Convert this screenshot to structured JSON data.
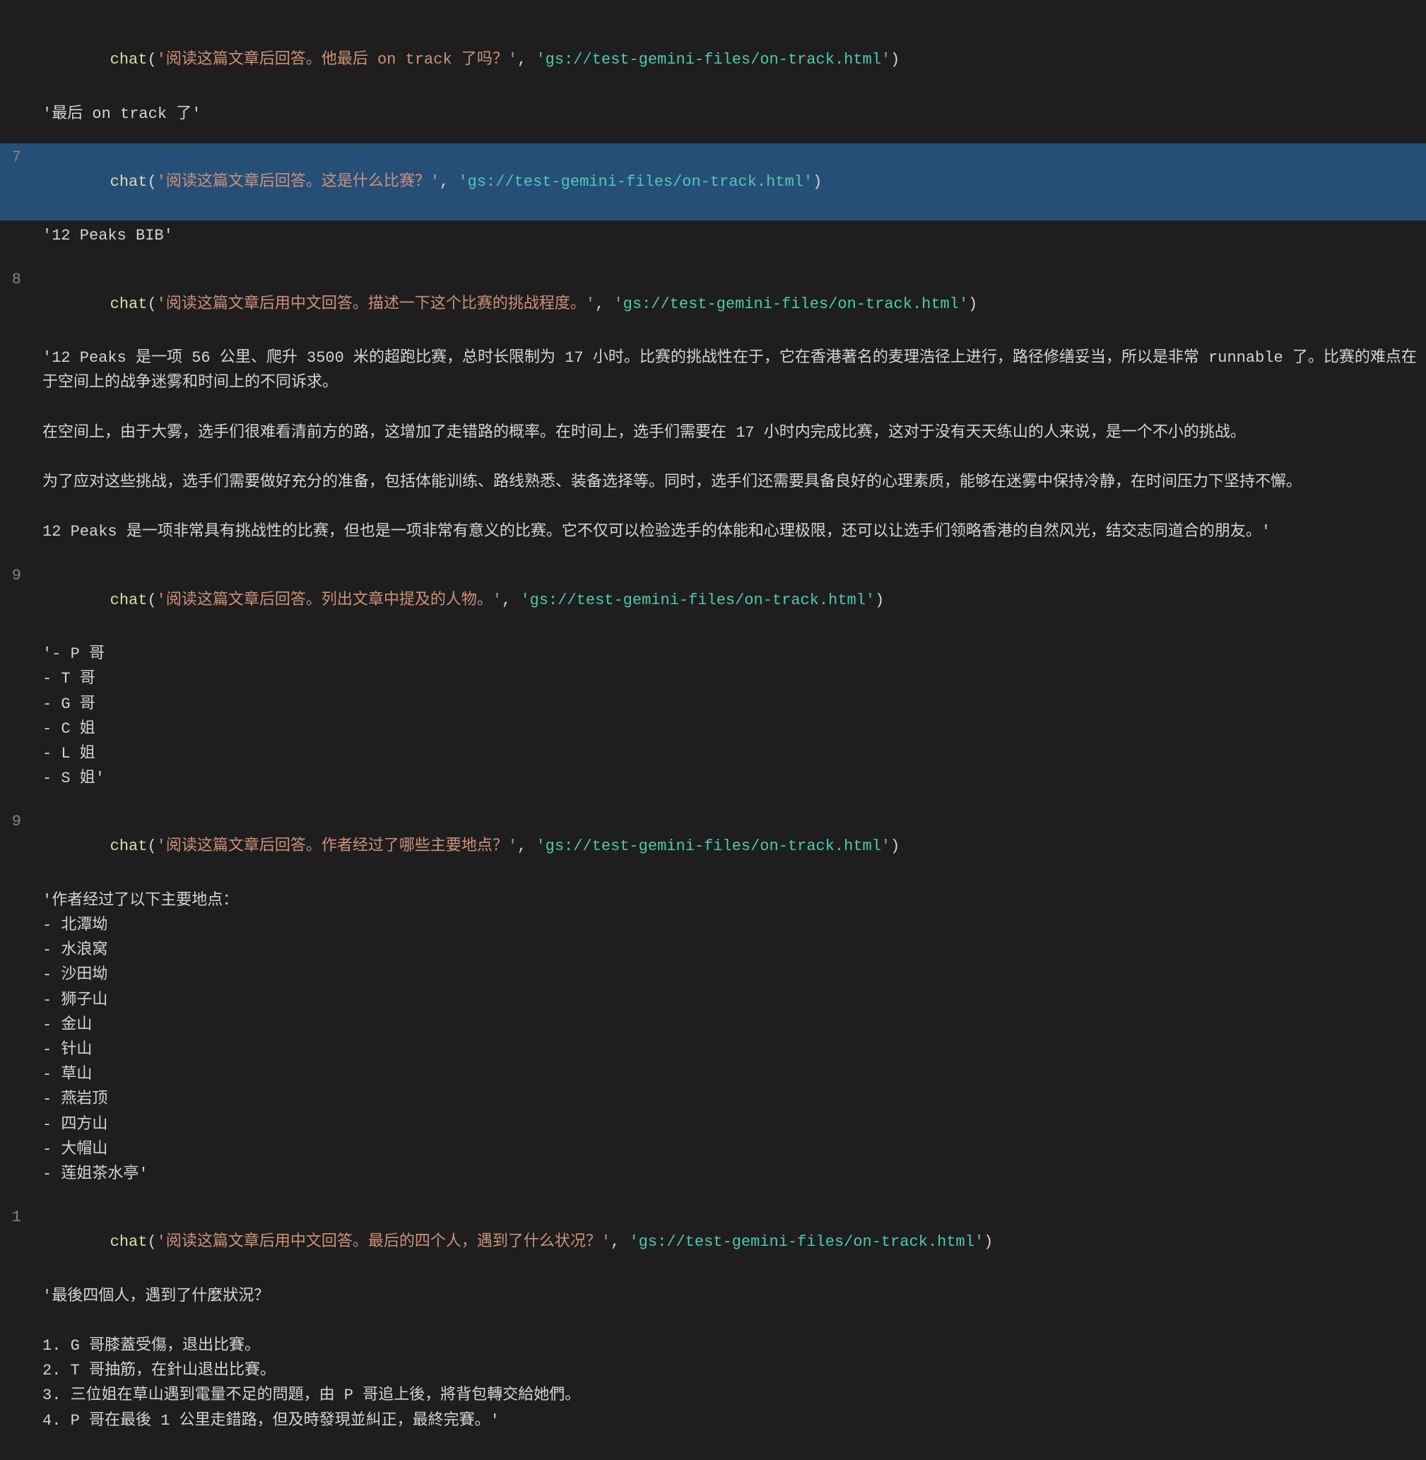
{
  "colors": {
    "background": "#1e1e1e",
    "text": "#d4d4d4",
    "lineNumber": "#858585",
    "keyword": "#dcdcaa",
    "stringRed": "#ce9178",
    "stringTeal": "#4ec9b0",
    "highlight": "#264f78"
  },
  "blocks": [
    {
      "id": "block1",
      "lineNum": "",
      "highlighted": false,
      "callParts": [
        {
          "type": "plain",
          "text": "  "
        },
        {
          "type": "keyword",
          "text": "chat"
        },
        {
          "type": "plain",
          "text": "("
        },
        {
          "type": "string",
          "text": "'阅读这篇文章后回答。他最后 on track 了吗？'"
        },
        {
          "type": "plain",
          "text": ", "
        },
        {
          "type": "string2",
          "text": "'gs://test-gemini-files/on-track.html'"
        },
        {
          "type": "plain",
          "text": ")"
        }
      ],
      "response": "'最后 on track 了'"
    },
    {
      "id": "block2",
      "lineNum": "7",
      "highlighted": true,
      "callParts": [
        {
          "type": "keyword",
          "text": "chat"
        },
        {
          "type": "plain",
          "text": "("
        },
        {
          "type": "string",
          "text": "'阅读这篇文章后回答。这是什么比赛？'"
        },
        {
          "type": "plain",
          "text": ", "
        },
        {
          "type": "string2",
          "text": "'gs://test-gemini-files/on-track.html'"
        },
        {
          "type": "plain",
          "text": ")"
        }
      ],
      "response": "'12 Peaks BIB'"
    },
    {
      "id": "block3",
      "lineNum": "8",
      "highlighted": false,
      "callParts": [
        {
          "type": "keyword",
          "text": "chat"
        },
        {
          "type": "plain",
          "text": "("
        },
        {
          "type": "string",
          "text": "'阅读这篇文章后用中文回答。描述一下这个比赛的挑战程度。'"
        },
        {
          "type": "plain",
          "text": ", "
        },
        {
          "type": "string2",
          "text": "'gs://test-gemini-files/on-track.html'"
        },
        {
          "type": "plain",
          "text": ")"
        }
      ],
      "response": "'12 Peaks 是一项 56 公里、爬升 3500 米的超跑比赛，总时长限制为 17 小时。比赛的挑战性在于，它在香港著名的麦理浩径上进行，路径修缮妥当，所以是非常 runnable 了。比赛的难点在于空间上的战争迷雾和时间上的不同诉求。\\n\\n在空间上，由于大雾，选手们很难看清前方的路，这增加了走错路的概率。在时间上，选手们需要在 17 小时内完成比赛，这对于没有天天练山的人来说，是一个不小的挑战。\\n\\n为了应对这些挑战，选手们需要做好充分的准备，包括体能训练、路线熟悉、装备选择等。同时，选手们还需要具备良好的心理素质，能够在迷雾中保持冷静，在时间压力下坚持不懈。\\n\\n12 Peaks 是一项非常具有挑战性的比赛，但也是一项非常有意义的比赛。它不仅可以检验选手的体能和心理极限，还可以让选手们领略香港的自然风光，结交志同道合的朋友。'"
    },
    {
      "id": "block4",
      "lineNum": "9",
      "highlighted": false,
      "callParts": [
        {
          "type": "keyword",
          "text": "chat"
        },
        {
          "type": "plain",
          "text": "("
        },
        {
          "type": "string",
          "text": "'阅读这篇文章后回答。列出文章中提及的人物。'"
        },
        {
          "type": "plain",
          "text": ", "
        },
        {
          "type": "string2",
          "text": "'gs://test-gemini-files/on-track.html'"
        },
        {
          "type": "plain",
          "text": ")"
        }
      ],
      "response": "'- P 哥\\n- T 哥\\n- G 哥\\n- C 姐\\n- L 姐\\n- S 姐'"
    },
    {
      "id": "block5",
      "lineNum": "9",
      "highlighted": false,
      "callParts": [
        {
          "type": "keyword",
          "text": "chat"
        },
        {
          "type": "plain",
          "text": "("
        },
        {
          "type": "string",
          "text": "'阅读这篇文章后回答。作者经过了哪些主要地点？'"
        },
        {
          "type": "plain",
          "text": ", "
        },
        {
          "type": "string2",
          "text": "'gs://test-gemini-files/on-track.html'"
        },
        {
          "type": "plain",
          "text": ")"
        }
      ],
      "response": "'作者经过了以下主要地点：\\n- 北潭坳\\n- 水浪窝\\n- 沙田坳\\n- 狮子山\\n- 金山\\n- 针山\\n- 草山\\n- 燕岩顶\\n- 四方山\\n- 大帽山\\n- 莲姐茶水亭'"
    },
    {
      "id": "block6",
      "lineNum": "1",
      "highlighted": false,
      "callParts": [
        {
          "type": "keyword",
          "text": "chat"
        },
        {
          "type": "plain",
          "text": "("
        },
        {
          "type": "string",
          "text": "'阅读这篇文章后用中文回答。最后的四个人，遇到了什么状况？'"
        },
        {
          "type": "plain",
          "text": ", "
        },
        {
          "type": "string2",
          "text": "'gs://test-gemini-files/on-track.html'"
        },
        {
          "type": "plain",
          "text": ")"
        }
      ],
      "response": "'最後四個人，遇到了什麼狀況？\\n\\n1. G 哥膝蓋受傷，退出比賽。\\n2. T 哥抽筋，在針山退出比賽。\\n3. 三位姐在草山遇到電量不足的問題，由 P 哥追上後，將背包轉交給她們。\\n4. P 哥在最後 1 公里走錯路，但及時發現並糾正，最終完賽。'"
    }
  ]
}
